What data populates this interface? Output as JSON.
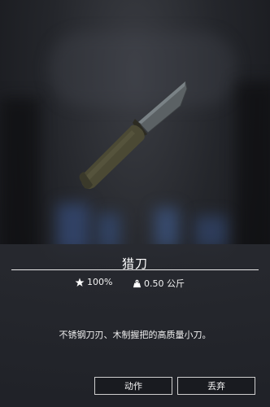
{
  "item": {
    "name": "猎刀",
    "condition": "100%",
    "weight": "0.50 公斤",
    "description": "不锈钢刀刃、木制握把的高质量小刀。",
    "icon": "hunting-knife"
  },
  "actions": {
    "action_label": "动作",
    "drop_label": "丢弃"
  },
  "colors": {
    "handle": "#4b4934",
    "blade": "#5b6164",
    "panel": "#2a2c31"
  }
}
